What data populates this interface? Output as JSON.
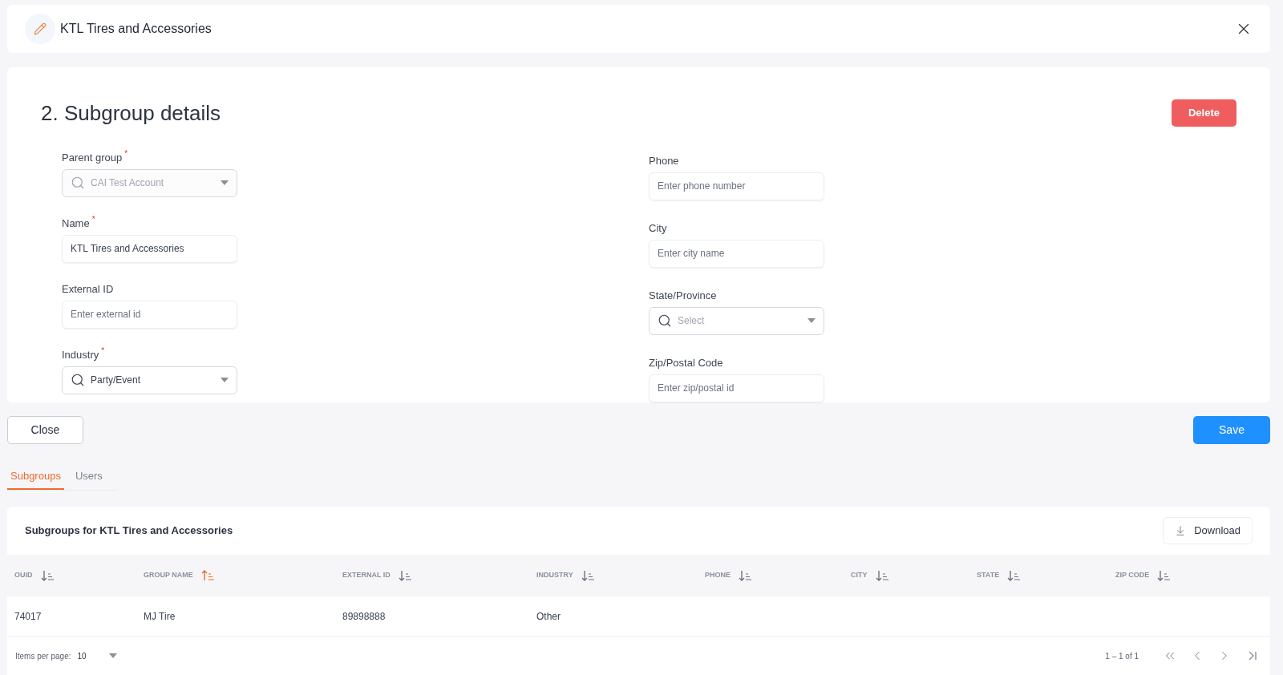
{
  "header": {
    "title": "KTL Tires and Accessories"
  },
  "details": {
    "title": "2. Subgroup details",
    "delete_button": "Delete",
    "left_fields": [
      {
        "kind": "select",
        "label": "Parent group",
        "required_mark": "*",
        "value": "CAI Test Account",
        "disabled": true
      },
      {
        "kind": "input",
        "label": "Name",
        "required_mark": "*",
        "value": "KTL Tires and Accessories"
      },
      {
        "kind": "input",
        "label": "External ID",
        "placeholder": "Enter external id"
      },
      {
        "kind": "select",
        "label": "Industry",
        "required_mark": "*",
        "value": "Party/Event",
        "disabled": false
      }
    ],
    "right_fields": [
      {
        "kind": "input",
        "label": "Phone",
        "placeholder": "Enter phone number"
      },
      {
        "kind": "input",
        "label": "City",
        "placeholder": "Enter city name"
      },
      {
        "kind": "select",
        "label": "State/Province",
        "placeholder": "Select",
        "disabled": false
      },
      {
        "kind": "input",
        "label": "Zip/Postal Code",
        "placeholder": "Enter zip/postal id"
      }
    ]
  },
  "actions": {
    "close": "Close",
    "save": "Save"
  },
  "tabs": [
    {
      "label": "Subgroups",
      "selected": true
    },
    {
      "label": "Users",
      "selected": false
    }
  ],
  "table": {
    "title": "Subgroups for KTL Tires and Accessories",
    "download": "Download",
    "columns": [
      {
        "label": "OUID",
        "sort_active": false
      },
      {
        "label": "GROUP NAME",
        "sort_active": true
      },
      {
        "label": "EXTERNAL ID",
        "sort_active": false
      },
      {
        "label": "INDUSTRY",
        "sort_active": false
      },
      {
        "label": "PHONE",
        "sort_active": false
      },
      {
        "label": "CITY",
        "sort_active": false
      },
      {
        "label": "STATE",
        "sort_active": false
      },
      {
        "label": "ZIP CODE",
        "sort_active": false
      }
    ],
    "rows": [
      [
        "74017",
        "MJ Tire",
        "89898888",
        "Other",
        "",
        "",
        "",
        ""
      ]
    ],
    "items_per_page_label": "Items per page:",
    "items_per_page": "10",
    "range": "1 – 1 of 1"
  }
}
